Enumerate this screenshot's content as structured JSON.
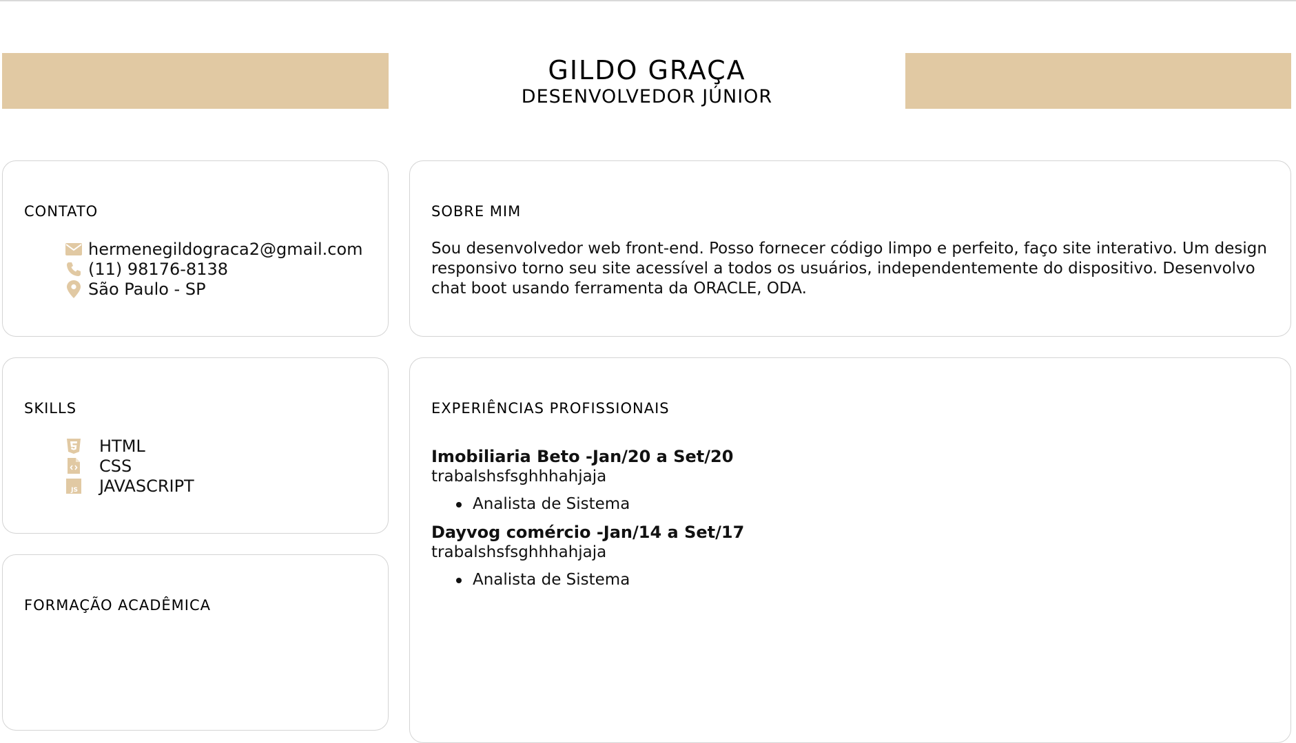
{
  "colors": {
    "accent": "#e1c9a3",
    "border": "#d4d4d4",
    "text": "#111111"
  },
  "header": {
    "name": "GILDO GRAÇA",
    "role": "DESENVOLVEDOR JÚNIOR"
  },
  "contact": {
    "title": "CONTATO",
    "items": [
      {
        "icon": "envelope-icon",
        "text": "hermenegildograca2@gmail.com"
      },
      {
        "icon": "phone-icon",
        "text": "(11) 98176-8138"
      },
      {
        "icon": "map-marker-icon",
        "text": "São Paulo - SP"
      }
    ]
  },
  "about": {
    "title": "SOBRE MIM",
    "text": "Sou desenvolvedor web front-end. Posso fornecer código limpo e perfeito, faço site interativo. Um design responsivo torno seu site acessível a todos os usuários, independentemente do dispositivo. Desenvolvo chat boot usando ferramenta da ORACLE, ODA."
  },
  "skills": {
    "title": "SKILLS",
    "items": [
      {
        "icon": "html5-icon",
        "label": "HTML"
      },
      {
        "icon": "css-file-icon",
        "label": "CSS"
      },
      {
        "icon": "js-icon",
        "label": "JAVASCRIPT"
      }
    ]
  },
  "education": {
    "title": "FORMAÇÃO ACADÊMICA"
  },
  "experience": {
    "title": "EXPERIÊNCIAS PROFISSIONAIS",
    "jobs": [
      {
        "title": "Imobiliaria Beto -Jan/20 a Set/20",
        "description": "trabalshsfsghhhahjaja",
        "roles": [
          "Analista de Sistema"
        ]
      },
      {
        "title": "Dayvog comércio -Jan/14 a Set/17",
        "description": "trabalshsfsghhhahjaja",
        "roles": [
          "Analista de Sistema"
        ]
      }
    ]
  }
}
